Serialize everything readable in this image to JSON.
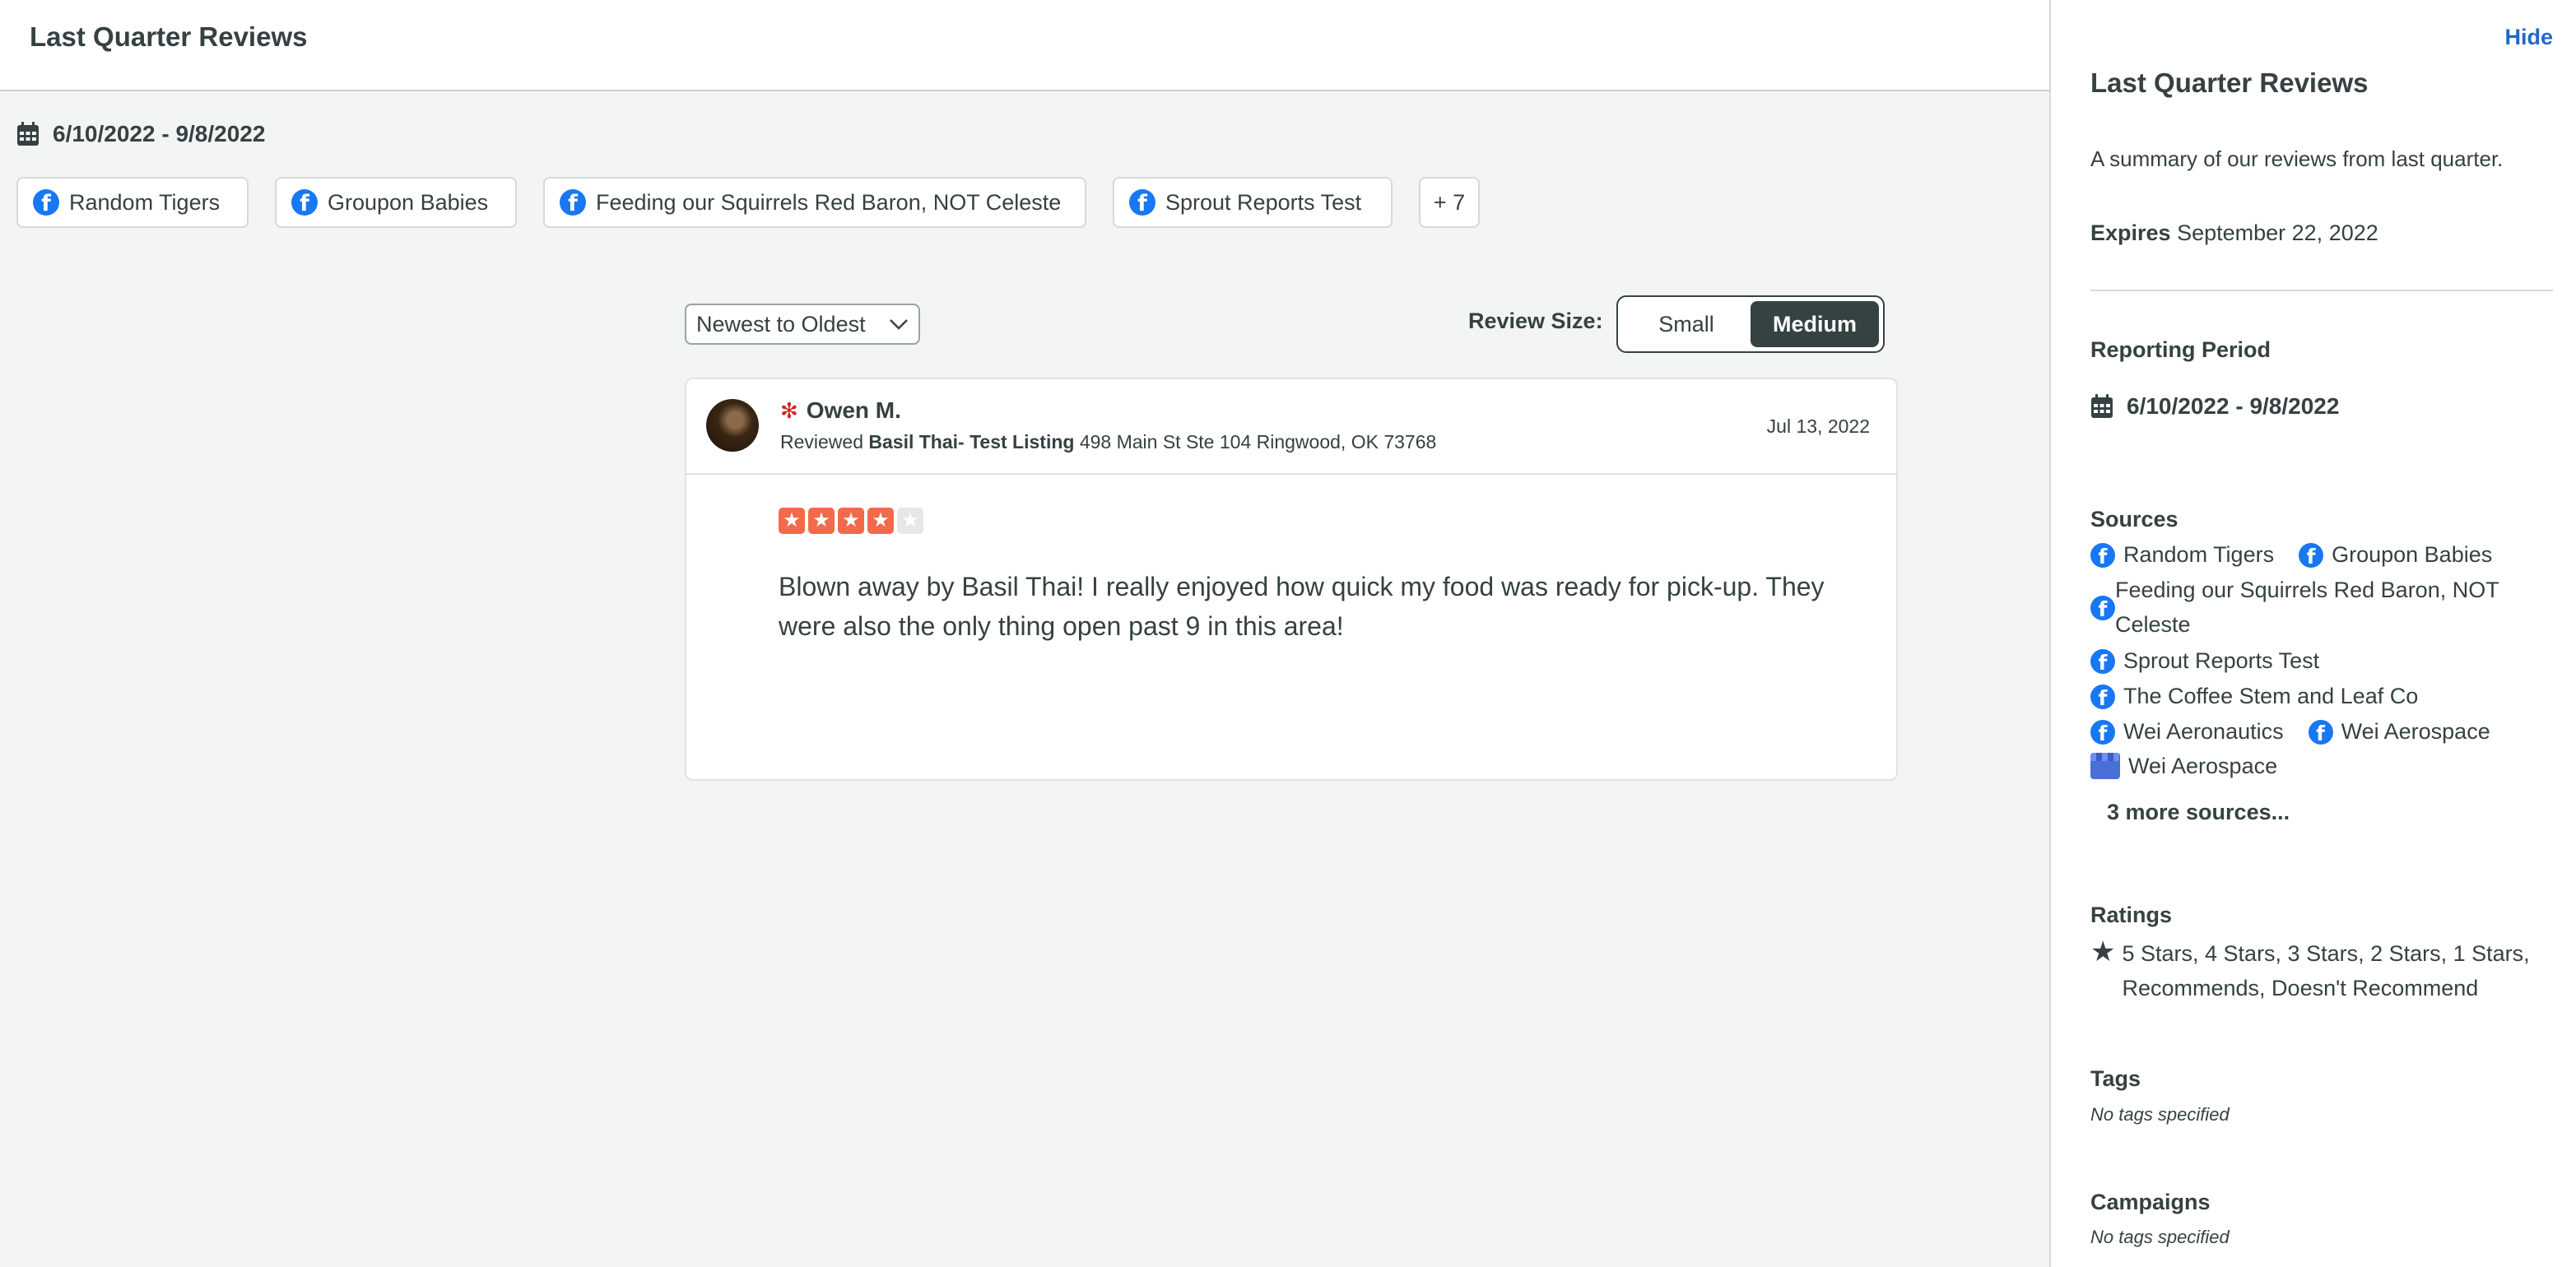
{
  "header": {
    "title": "Last Quarter Reviews"
  },
  "filters": {
    "date_range": "6/10/2022 - 9/8/2022",
    "chips": [
      {
        "label": "Random Tigers",
        "icon": "facebook-icon"
      },
      {
        "label": "Groupon Babies",
        "icon": "facebook-icon"
      },
      {
        "label": "Feeding our Squirrels Red Baron, NOT Celeste",
        "icon": "facebook-icon"
      },
      {
        "label": "Sprout Reports Test",
        "icon": "facebook-icon"
      }
    ],
    "more_chip": "+ 7"
  },
  "controls": {
    "sort_value": "Newest to Oldest",
    "review_size_label": "Review Size:",
    "size_options": [
      "Small",
      "Medium"
    ],
    "size_selected": "Medium"
  },
  "review": {
    "author": "Owen M.",
    "network_icon": "yelp-icon",
    "reviewed_prefix": "Reviewed",
    "listing_name": "Basil Thai- Test Listing",
    "address": "498 Main St Ste 104 Ringwood, OK 73768",
    "date": "Jul 13, 2022",
    "rating": 4,
    "rating_max": 5,
    "text": "Blown away by Basil Thai! I really enjoyed how quick my food was ready for pick-up. They were also the only thing open past 9 in this area!"
  },
  "panel": {
    "hide_label": "Hide",
    "title": "Last Quarter Reviews",
    "description": "A summary of our reviews from last quarter.",
    "expires_label": "Expires",
    "expires_value": "September 22, 2022",
    "reporting_period_heading": "Reporting Period",
    "reporting_period": "6/10/2022 - 9/8/2022",
    "sources_heading": "Sources",
    "sources": [
      {
        "label": "Random Tigers",
        "icon": "facebook-icon"
      },
      {
        "label": "Groupon Babies",
        "icon": "facebook-icon"
      },
      {
        "label": "Feeding our Squirrels Red Baron, NOT Celeste",
        "icon": "facebook-icon"
      },
      {
        "label": "Sprout Reports Test",
        "icon": "facebook-icon"
      },
      {
        "label": "The Coffee Stem and Leaf Co",
        "icon": "facebook-icon"
      },
      {
        "label": "Wei Aeronautics",
        "icon": "facebook-icon"
      },
      {
        "label": "Wei Aerospace",
        "icon": "facebook-icon"
      },
      {
        "label": "Wei Aerospace",
        "icon": "google-my-business-icon"
      }
    ],
    "more_sources": "3 more sources...",
    "ratings_heading": "Ratings",
    "ratings_text": "5 Stars, 4 Stars, 3 Stars, 2 Stars, 1 Stars, Recommends, Doesn't Recommend",
    "tags_heading": "Tags",
    "tags_empty": "No tags specified",
    "campaigns_heading": "Campaigns",
    "campaigns_empty": "No tags specified"
  },
  "colors": {
    "text": "#364141",
    "link": "#2268c9",
    "facebook": "#1877f2",
    "yelp": "#d32323",
    "star": "#f26a4b",
    "background": "#f3f4f4"
  }
}
